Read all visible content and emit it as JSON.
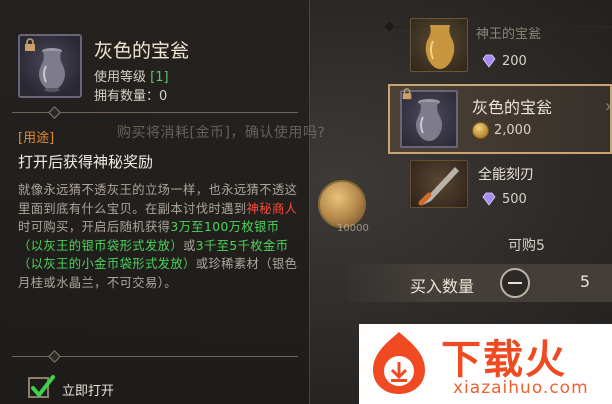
{
  "tooltip": {
    "item_name": "灰色的宝瓮",
    "level_prefix": "使用等级 ",
    "level_value": "[1]",
    "owned_label": "拥有数量：",
    "owned_value": "0",
    "usage_label": "[用途]",
    "usage_headline": "打开后获得神秘奖励",
    "desc": {
      "p1": "就像永远猜不透灰王的立场一样，也永远猜不透这里面到底有什么宝贝。在副本讨伐时遇到",
      "npc": "神秘商人",
      "p2": "时可购买，开启后随机获得",
      "silver": "3万至100万枚银币（以灰王的银币袋形式发放）",
      "p3": "或",
      "gold": "3千至5千枚金币（以灰王的小金币袋形式发放）",
      "p4": "或珍稀素材（银色月桂或水晶兰，不可交易）。"
    },
    "open_immediately_label": "立即打开",
    "open_immediately_checked": true
  },
  "confirm_prompt": "购买将消耗[金币]，确认使用吗?",
  "confirm_coin_amount": "10000",
  "shop": {
    "items": [
      {
        "name": "神王的宝瓮",
        "price": "200",
        "currency": "diamond-icon"
      },
      {
        "name": "灰色的宝瓮",
        "price": "2,000",
        "currency": "gold-coin-icon",
        "selected": true
      },
      {
        "name": "全能刻刃",
        "price": "500",
        "currency": "diamond-icon"
      }
    ],
    "can_buy_label": "可购5",
    "quantity_label": "买入数量",
    "quantity_value": "5"
  },
  "watermark": {
    "main_text": "下载火",
    "sub_text": "xiazaihuo.com"
  },
  "colors": {
    "accent_orange": "#e08a3a",
    "npc_red": "#ff4a3c",
    "reward_green": "#4dd35a",
    "selected_border": "#c9a574",
    "watermark_red": "#f04a22"
  }
}
